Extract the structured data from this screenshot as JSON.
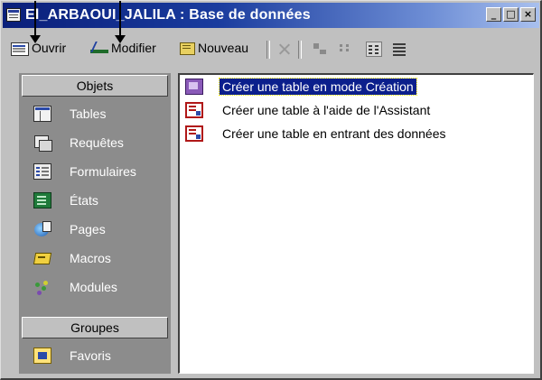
{
  "window": {
    "title": "El_ARBAOUI_JALILA : Base de données",
    "buttons": {
      "minimize": "_",
      "maximize": "□",
      "close": "×"
    }
  },
  "toolbar": {
    "open_label": "Ouvrir",
    "design_label": "Modifier",
    "new_label": "Nouveau",
    "open_icon": "open-icon",
    "design_icon": "design-icon",
    "new_icon": "new-icon",
    "view_icons": [
      "delete-icon",
      "large-icons-icon",
      "small-icons-icon",
      "list-view-icon",
      "details-view-icon"
    ]
  },
  "objects_bar": {
    "objects_header": "Objets",
    "items": [
      {
        "label": "Tables",
        "icon": "table-icon"
      },
      {
        "label": "Requêtes",
        "icon": "query-icon"
      },
      {
        "label": "Formulaires",
        "icon": "form-icon"
      },
      {
        "label": "États",
        "icon": "report-icon"
      },
      {
        "label": "Pages",
        "icon": "page-icon"
      },
      {
        "label": "Macros",
        "icon": "macro-icon"
      },
      {
        "label": "Modules",
        "icon": "module-icon"
      }
    ],
    "groups_header": "Groupes",
    "groups": [
      {
        "label": "Favoris",
        "icon": "favorites-icon"
      }
    ]
  },
  "list": {
    "items": [
      {
        "label": "Créer une table en mode Création",
        "selected": true
      },
      {
        "label": "Créer une table à l'aide de l'Assistant",
        "selected": false
      },
      {
        "label": "Créer une table en entrant des données",
        "selected": false
      }
    ]
  },
  "colors": {
    "title_bar_start": "#0a1f7a",
    "title_bar_end": "#a9c0ee",
    "objects_bar_bg": "#8c8c8c",
    "selection_bg": "#0b1f8c"
  }
}
